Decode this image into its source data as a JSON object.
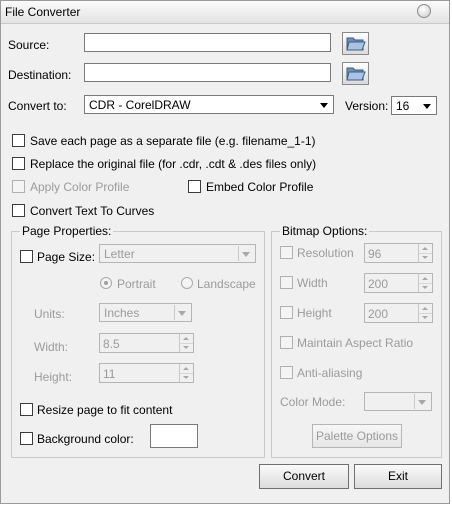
{
  "window": {
    "title": "File Converter"
  },
  "source": {
    "label": "Source:",
    "value": ""
  },
  "destination": {
    "label": "Destination:",
    "value": ""
  },
  "convert_to": {
    "label": "Convert to:",
    "value": "CDR - CorelDRAW"
  },
  "version": {
    "label": "Version:",
    "value": "16"
  },
  "options": {
    "save_each_page": "Save each page as a separate file (e.g. filename_1-1)",
    "replace_original": "Replace the original file (for .cdr, .cdt & .des files only)",
    "apply_color_profile": "Apply Color Profile",
    "embed_color_profile": "Embed Color Profile",
    "convert_text": "Convert Text To Curves"
  },
  "page_properties": {
    "title": "Page Properties:",
    "page_size_label": "Page Size:",
    "page_size_value": "Letter",
    "portrait": "Portrait",
    "landscape": "Landscape",
    "units_label": "Units:",
    "units_value": "Inches",
    "width_label": "Width:",
    "width_value": "8.5",
    "height_label": "Height:",
    "height_value": "11",
    "resize_label": "Resize page to fit content",
    "background_label": "Background color:",
    "background_color": "#ffffff"
  },
  "bitmap_options": {
    "title": "Bitmap Options:",
    "resolution_label": "Resolution",
    "resolution_value": "96",
    "width_label": "Width",
    "width_value": "200",
    "height_label": "Height",
    "height_value": "200",
    "maintain_label": "Maintain Aspect Ratio",
    "antialias_label": "Anti-aliasing",
    "color_mode_label": "Color Mode:",
    "color_mode_value": "",
    "palette_button": "Palette Options"
  },
  "buttons": {
    "convert": "Convert",
    "exit": "Exit"
  }
}
